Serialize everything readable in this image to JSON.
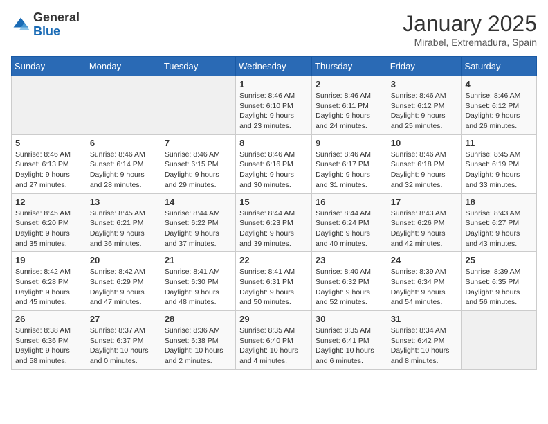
{
  "header": {
    "logo_general": "General",
    "logo_blue": "Blue",
    "title": "January 2025",
    "subtitle": "Mirabel, Extremadura, Spain"
  },
  "days_of_week": [
    "Sunday",
    "Monday",
    "Tuesday",
    "Wednesday",
    "Thursday",
    "Friday",
    "Saturday"
  ],
  "weeks": [
    [
      {
        "day": "",
        "detail": ""
      },
      {
        "day": "",
        "detail": ""
      },
      {
        "day": "",
        "detail": ""
      },
      {
        "day": "1",
        "detail": "Sunrise: 8:46 AM\nSunset: 6:10 PM\nDaylight: 9 hours and 23 minutes."
      },
      {
        "day": "2",
        "detail": "Sunrise: 8:46 AM\nSunset: 6:11 PM\nDaylight: 9 hours and 24 minutes."
      },
      {
        "day": "3",
        "detail": "Sunrise: 8:46 AM\nSunset: 6:12 PM\nDaylight: 9 hours and 25 minutes."
      },
      {
        "day": "4",
        "detail": "Sunrise: 8:46 AM\nSunset: 6:12 PM\nDaylight: 9 hours and 26 minutes."
      }
    ],
    [
      {
        "day": "5",
        "detail": "Sunrise: 8:46 AM\nSunset: 6:13 PM\nDaylight: 9 hours and 27 minutes."
      },
      {
        "day": "6",
        "detail": "Sunrise: 8:46 AM\nSunset: 6:14 PM\nDaylight: 9 hours and 28 minutes."
      },
      {
        "day": "7",
        "detail": "Sunrise: 8:46 AM\nSunset: 6:15 PM\nDaylight: 9 hours and 29 minutes."
      },
      {
        "day": "8",
        "detail": "Sunrise: 8:46 AM\nSunset: 6:16 PM\nDaylight: 9 hours and 30 minutes."
      },
      {
        "day": "9",
        "detail": "Sunrise: 8:46 AM\nSunset: 6:17 PM\nDaylight: 9 hours and 31 minutes."
      },
      {
        "day": "10",
        "detail": "Sunrise: 8:46 AM\nSunset: 6:18 PM\nDaylight: 9 hours and 32 minutes."
      },
      {
        "day": "11",
        "detail": "Sunrise: 8:45 AM\nSunset: 6:19 PM\nDaylight: 9 hours and 33 minutes."
      }
    ],
    [
      {
        "day": "12",
        "detail": "Sunrise: 8:45 AM\nSunset: 6:20 PM\nDaylight: 9 hours and 35 minutes."
      },
      {
        "day": "13",
        "detail": "Sunrise: 8:45 AM\nSunset: 6:21 PM\nDaylight: 9 hours and 36 minutes."
      },
      {
        "day": "14",
        "detail": "Sunrise: 8:44 AM\nSunset: 6:22 PM\nDaylight: 9 hours and 37 minutes."
      },
      {
        "day": "15",
        "detail": "Sunrise: 8:44 AM\nSunset: 6:23 PM\nDaylight: 9 hours and 39 minutes."
      },
      {
        "day": "16",
        "detail": "Sunrise: 8:44 AM\nSunset: 6:24 PM\nDaylight: 9 hours and 40 minutes."
      },
      {
        "day": "17",
        "detail": "Sunrise: 8:43 AM\nSunset: 6:26 PM\nDaylight: 9 hours and 42 minutes."
      },
      {
        "day": "18",
        "detail": "Sunrise: 8:43 AM\nSunset: 6:27 PM\nDaylight: 9 hours and 43 minutes."
      }
    ],
    [
      {
        "day": "19",
        "detail": "Sunrise: 8:42 AM\nSunset: 6:28 PM\nDaylight: 9 hours and 45 minutes."
      },
      {
        "day": "20",
        "detail": "Sunrise: 8:42 AM\nSunset: 6:29 PM\nDaylight: 9 hours and 47 minutes."
      },
      {
        "day": "21",
        "detail": "Sunrise: 8:41 AM\nSunset: 6:30 PM\nDaylight: 9 hours and 48 minutes."
      },
      {
        "day": "22",
        "detail": "Sunrise: 8:41 AM\nSunset: 6:31 PM\nDaylight: 9 hours and 50 minutes."
      },
      {
        "day": "23",
        "detail": "Sunrise: 8:40 AM\nSunset: 6:32 PM\nDaylight: 9 hours and 52 minutes."
      },
      {
        "day": "24",
        "detail": "Sunrise: 8:39 AM\nSunset: 6:34 PM\nDaylight: 9 hours and 54 minutes."
      },
      {
        "day": "25",
        "detail": "Sunrise: 8:39 AM\nSunset: 6:35 PM\nDaylight: 9 hours and 56 minutes."
      }
    ],
    [
      {
        "day": "26",
        "detail": "Sunrise: 8:38 AM\nSunset: 6:36 PM\nDaylight: 9 hours and 58 minutes."
      },
      {
        "day": "27",
        "detail": "Sunrise: 8:37 AM\nSunset: 6:37 PM\nDaylight: 10 hours and 0 minutes."
      },
      {
        "day": "28",
        "detail": "Sunrise: 8:36 AM\nSunset: 6:38 PM\nDaylight: 10 hours and 2 minutes."
      },
      {
        "day": "29",
        "detail": "Sunrise: 8:35 AM\nSunset: 6:40 PM\nDaylight: 10 hours and 4 minutes."
      },
      {
        "day": "30",
        "detail": "Sunrise: 8:35 AM\nSunset: 6:41 PM\nDaylight: 10 hours and 6 minutes."
      },
      {
        "day": "31",
        "detail": "Sunrise: 8:34 AM\nSunset: 6:42 PM\nDaylight: 10 hours and 8 minutes."
      },
      {
        "day": "",
        "detail": ""
      }
    ]
  ]
}
